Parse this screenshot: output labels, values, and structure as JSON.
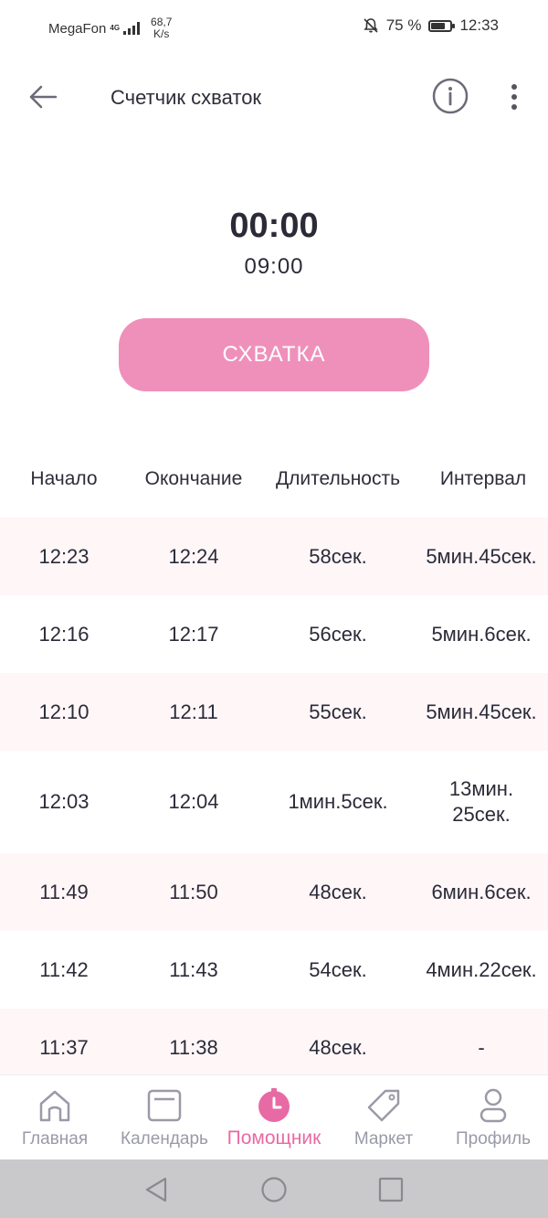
{
  "status_bar": {
    "carrier": "MegaFon",
    "network": "4G",
    "speed_value": "68,7",
    "speed_unit": "K/s",
    "battery": "75 %",
    "battery_level": 0.75,
    "time": "12:33"
  },
  "header": {
    "title": "Счетчик схваток",
    "back_icon": "arrow-left-icon",
    "info_icon": "info-icon",
    "more_icon": "more-vertical-icon"
  },
  "timer": {
    "current": "00:00",
    "elapsed": "09:00"
  },
  "contraction_button": {
    "label": "СХВАТКА",
    "color": "#ef90bb"
  },
  "table": {
    "columns": [
      "Начало",
      "Окончание",
      "Длительность",
      "Интервал"
    ],
    "rows": [
      {
        "start": "12:23",
        "end": "12:24",
        "duration": "58сек.",
        "interval": "5мин.45сек."
      },
      {
        "start": "12:16",
        "end": "12:17",
        "duration": "56сек.",
        "interval": "5мин.6сек."
      },
      {
        "start": "12:10",
        "end": "12:11",
        "duration": "55сек.",
        "interval": "5мин.45сек."
      },
      {
        "start": "12:03",
        "end": "12:04",
        "duration": "1мин.5сек.",
        "interval_line1": "13мин.",
        "interval_line2": "25сек."
      },
      {
        "start": "11:49",
        "end": "11:50",
        "duration": "48сек.",
        "interval": "6мин.6сек."
      },
      {
        "start": "11:42",
        "end": "11:43",
        "duration": "54сек.",
        "interval": "4мин.22сек."
      },
      {
        "start": "11:37",
        "end": "11:38",
        "duration": "48сек.",
        "interval": "-"
      }
    ]
  },
  "bottom_nav": {
    "items": [
      {
        "label": "Главная",
        "icon": "home-icon"
      },
      {
        "label": "Календарь",
        "icon": "calendar-icon"
      },
      {
        "label": "Помощник",
        "icon": "stopwatch-icon",
        "active": true
      },
      {
        "label": "Маркет",
        "icon": "tag-icon"
      },
      {
        "label": "Профиль",
        "icon": "profile-icon"
      }
    ],
    "active_color": "#e86aa4",
    "inactive_color": "#999aa8"
  },
  "system_nav": {
    "back": "back-triangle-icon",
    "home": "home-circle-icon",
    "recents": "recents-square-icon"
  }
}
